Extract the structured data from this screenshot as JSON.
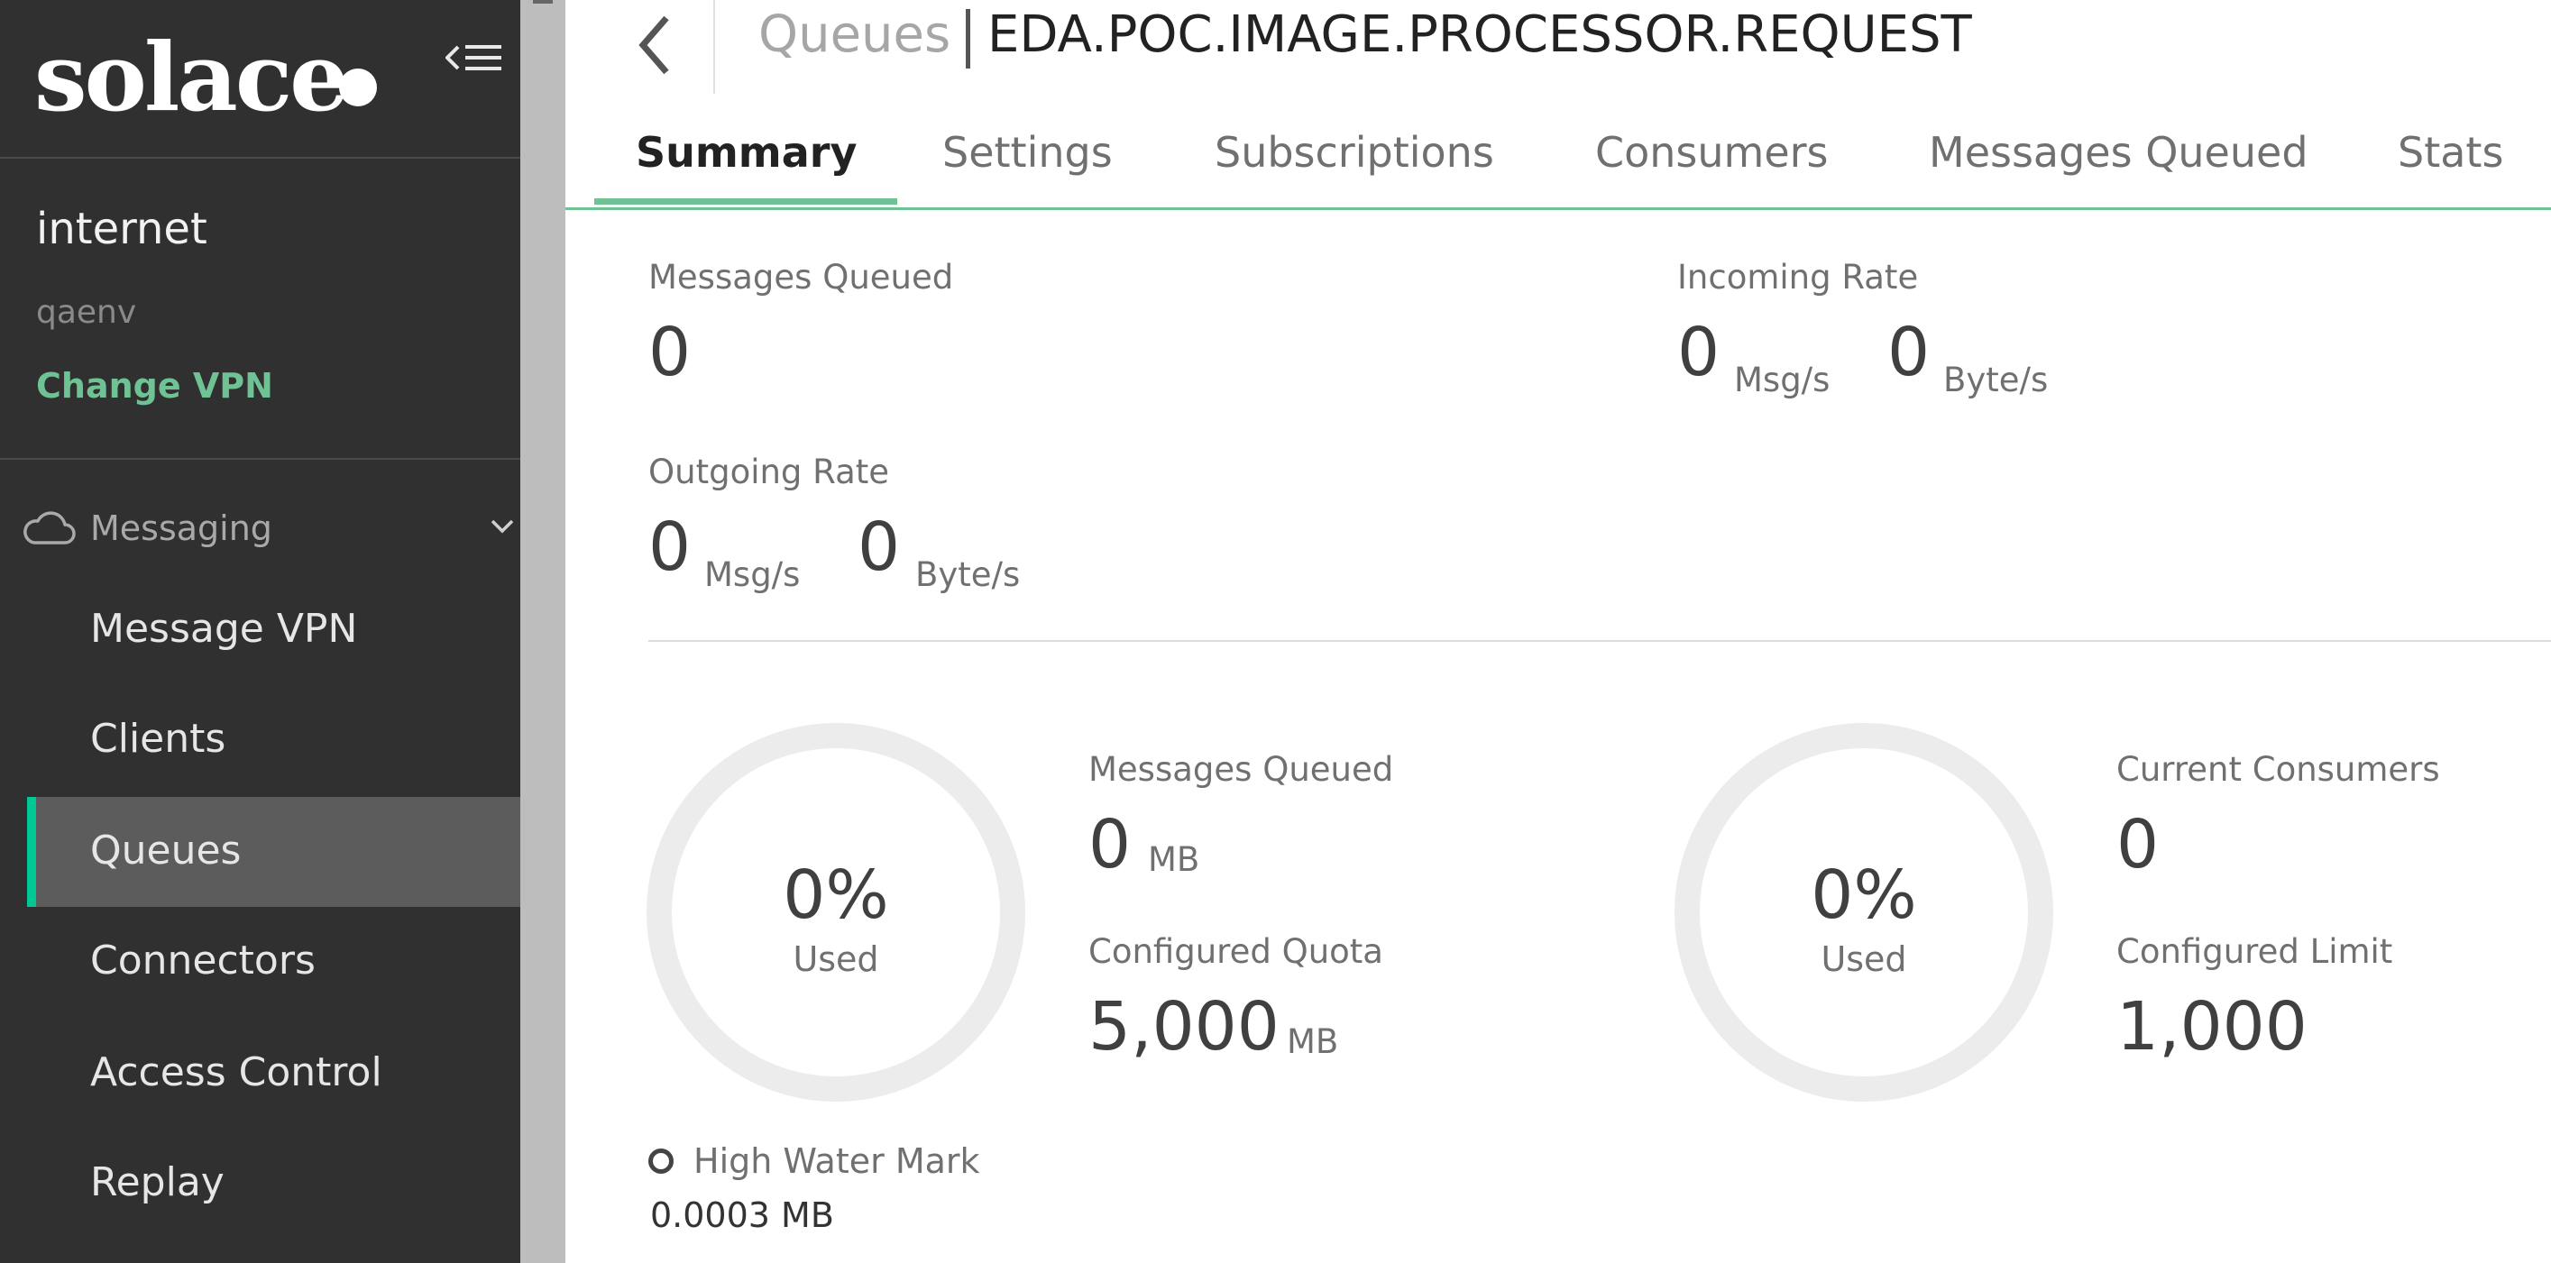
{
  "sidebar": {
    "brand": "solace",
    "vpn_name": "internet",
    "vpn_env": "qaenv",
    "change_vpn": "Change VPN",
    "section": "Messaging",
    "items": [
      {
        "label": "Message VPN"
      },
      {
        "label": "Clients"
      },
      {
        "label": "Queues",
        "active": true
      },
      {
        "label": "Connectors"
      },
      {
        "label": "Access Control"
      },
      {
        "label": "Replay"
      }
    ]
  },
  "header": {
    "breadcrumb": "Queues",
    "title": "EDA.POC.IMAGE.PROCESSOR.REQUEST"
  },
  "tabs": [
    {
      "label": "Summary",
      "active": true
    },
    {
      "label": "Settings"
    },
    {
      "label": "Subscriptions"
    },
    {
      "label": "Consumers"
    },
    {
      "label": "Messages Queued"
    },
    {
      "label": "Stats"
    }
  ],
  "summary": {
    "messages_queued": {
      "label": "Messages Queued",
      "value": "0"
    },
    "incoming_rate": {
      "label": "Incoming Rate",
      "msg_value": "0",
      "msg_unit": "Msg/s",
      "byte_value": "0",
      "byte_unit": "Byte/s"
    },
    "outgoing_rate": {
      "label": "Outgoing Rate",
      "msg_value": "0",
      "msg_unit": "Msg/s",
      "byte_value": "0",
      "byte_unit": "Byte/s"
    }
  },
  "storage": {
    "percent": "0%",
    "used_label": "Used",
    "queued_label": "Messages Queued",
    "queued_value": "0",
    "queued_unit": "MB",
    "quota_label": "Configured Quota",
    "quota_value": "5,000",
    "quota_unit": "MB",
    "hwm_label": "High Water Mark",
    "hwm_value": "0.0003 MB"
  },
  "consumers": {
    "percent": "0%",
    "used_label": "Used",
    "current_label": "Current Consumers",
    "current_value": "0",
    "limit_label": "Configured Limit",
    "limit_value": "1,000"
  },
  "colors": {
    "accent": "#6fc293",
    "active_bar": "#00c895",
    "sidebar_bg": "#303030"
  },
  "icons": [
    "collapse-sidebar-icon",
    "cloud-icon",
    "chevron-down-icon",
    "back-arrow-icon",
    "high-water-mark-icon"
  ]
}
